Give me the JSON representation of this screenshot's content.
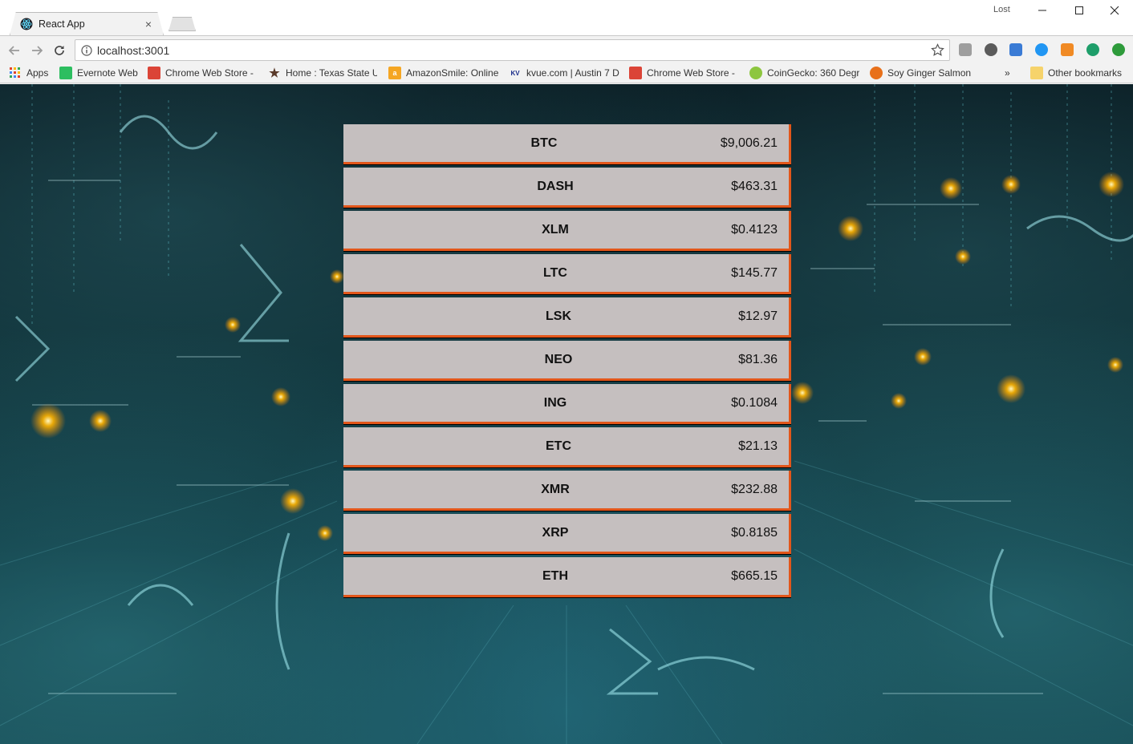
{
  "browser": {
    "tab_title": "React App",
    "tab_favicon": "react-logo-icon",
    "user_label": "Lost",
    "url": "localhost:3001"
  },
  "bookmarks": [
    {
      "label": "Apps",
      "icon": "apps-grid-icon"
    },
    {
      "label": "Evernote Web",
      "icon": "evernote-icon"
    },
    {
      "label": "Chrome Web Store -",
      "icon": "chrome-web-store-icon"
    },
    {
      "label": "Home : Texas State U",
      "icon": "star-icon"
    },
    {
      "label": "AmazonSmile: Online",
      "icon": "amazon-icon"
    },
    {
      "label": "kvue.com | Austin 7 D",
      "icon": "kvue-icon"
    },
    {
      "label": "Chrome Web Store -",
      "icon": "chrome-web-store-icon"
    },
    {
      "label": "CoinGecko: 360 Degr",
      "icon": "coingecko-icon"
    },
    {
      "label": "Soy Ginger Salmon",
      "icon": "recipe-icon"
    },
    {
      "label": "»",
      "icon": "overflow-icon"
    },
    {
      "label": "Other bookmarks",
      "icon": "folder-icon"
    }
  ],
  "coins": [
    {
      "symbol": "BTC",
      "price": "$9,006.21"
    },
    {
      "symbol": "DASH",
      "price": "$463.31"
    },
    {
      "symbol": "XLM",
      "price": "$0.4123"
    },
    {
      "symbol": "LTC",
      "price": "$145.77"
    },
    {
      "symbol": "LSK",
      "price": "$12.97"
    },
    {
      "symbol": "NEO",
      "price": "$81.36"
    },
    {
      "symbol": "ING",
      "price": "$0.1084"
    },
    {
      "symbol": "ETC",
      "price": "$21.13"
    },
    {
      "symbol": "XMR",
      "price": "$232.88"
    },
    {
      "symbol": "XRP",
      "price": "$0.8185"
    },
    {
      "symbol": "ETH",
      "price": "$665.15"
    }
  ],
  "colors": {
    "row_background": "#c5bfbf",
    "row_accent": "#e2561a",
    "background_teal": "#0b3038"
  }
}
